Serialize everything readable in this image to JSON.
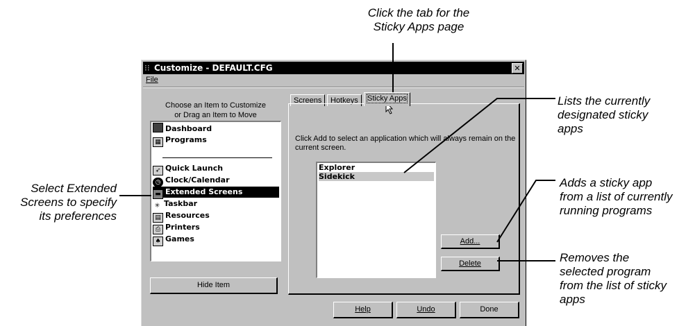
{
  "callouts": {
    "tab": "Click the tab for the\nSticky Apps page",
    "lists": "Lists the currently\ndesignated sticky\napps",
    "add": "Adds a sticky app\nfrom a list of currently\nrunning programs",
    "remove": "Removes the\nselected program\nfrom the list of sticky\napps",
    "select": "Select Extended\nScreens to specify\nits preferences"
  },
  "window": {
    "title": "Customize - DEFAULT.CFG",
    "close_glyph": "✕",
    "menu": [
      "File"
    ]
  },
  "left": {
    "instruction": "Choose an Item to Customize\nor Drag an Item to Move",
    "items": [
      {
        "label": "Dashboard",
        "icon": "dashboard-icon"
      },
      {
        "label": "Programs",
        "icon": "programs-icon"
      },
      {
        "label": "Quick Launch",
        "icon": "quick-launch-icon"
      },
      {
        "label": "Clock/Calendar",
        "icon": "clock-icon"
      },
      {
        "label": "Extended Screens",
        "icon": "extended-screens-icon",
        "selected": true
      },
      {
        "label": "Taskbar",
        "icon": "taskbar-icon"
      },
      {
        "label": "Resources",
        "icon": "resources-icon"
      },
      {
        "label": "Printers",
        "icon": "printers-icon"
      },
      {
        "label": "Games",
        "icon": "games-icon"
      }
    ],
    "hide_button": "Hide Item"
  },
  "tabs": [
    "Screens",
    "Hotkeys",
    "Sticky Apps"
  ],
  "active_tab": "Sticky Apps",
  "description": "Click Add to select an application which will always remain on the current screen.",
  "sticky_apps": [
    "Explorer",
    "Sidekick"
  ],
  "buttons": {
    "add": "Add...",
    "delete": "Delete",
    "help": "Help",
    "undo": "Undo",
    "done": "Done"
  }
}
